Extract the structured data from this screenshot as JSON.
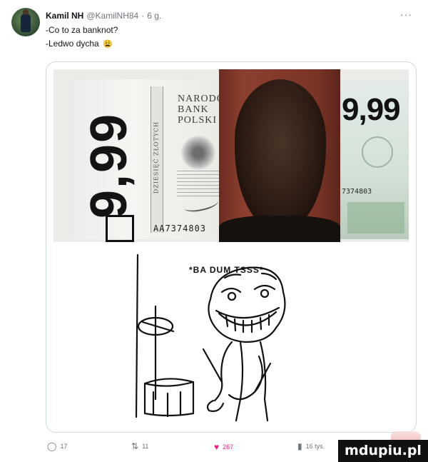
{
  "tweet": {
    "author_name": "Kamil NH",
    "author_handle": "@KamilNH84",
    "separator": "·",
    "time": "6 g.",
    "more": "···",
    "lines": [
      "-Co to za banknot?",
      "-Ledwo dycha"
    ],
    "emoji": "😩"
  },
  "media": {
    "banknote": {
      "denomination_left": "9,99",
      "denomination_right": "9,99",
      "bank_text": [
        "NARODOW",
        "BANK",
        "POLSKI"
      ],
      "strip_text": "DZIESIĘĆ ZŁOTYCH",
      "serial_left": "AA7374803",
      "serial_right": "7374803"
    },
    "meme": {
      "caption": "*BA DUM TSSS*"
    }
  },
  "actions": {
    "replies": "17",
    "retweets": "11",
    "likes": "267",
    "views": "16 tys."
  },
  "watermark": "mdupiu.pl",
  "colors": {
    "like_accent": "#f91880",
    "muted_text": "#6e767d",
    "border": "#cfd9de"
  }
}
